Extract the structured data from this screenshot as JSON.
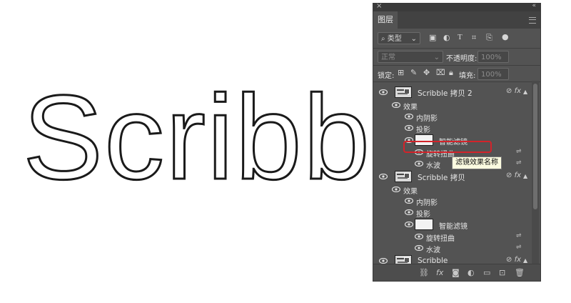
{
  "canvas": {
    "text": "Scribbl"
  },
  "panel": {
    "title_tab": "图层",
    "filter": {
      "label": "类型"
    },
    "blend_mode": "正常",
    "opacity_label": "不透明度:",
    "opacity_value": "100%",
    "lock_label": "锁定:",
    "fill_label": "填充:",
    "fill_value": "100%"
  },
  "layers": [
    {
      "name": "Scribble 拷贝 2",
      "effects_label": "效果",
      "effects": [
        "内阴影",
        "投影"
      ],
      "smart_filters_label": "智能滤镜",
      "filters": [
        "旋转扭曲",
        "水波"
      ]
    },
    {
      "name": "Scribble 拷贝",
      "effects_label": "效果",
      "effects": [
        "内阴影",
        "投影"
      ],
      "smart_filters_label": "智能滤镜",
      "filters": [
        "旋转扭曲",
        "水波"
      ]
    },
    {
      "name": "Scribble"
    }
  ],
  "fx_label": "fx",
  "tooltip": "滤镜效果名称",
  "colors": {
    "panel_bg": "#535353",
    "highlight": "#d3232a",
    "tooltip_bg": "#fbfbe0"
  }
}
